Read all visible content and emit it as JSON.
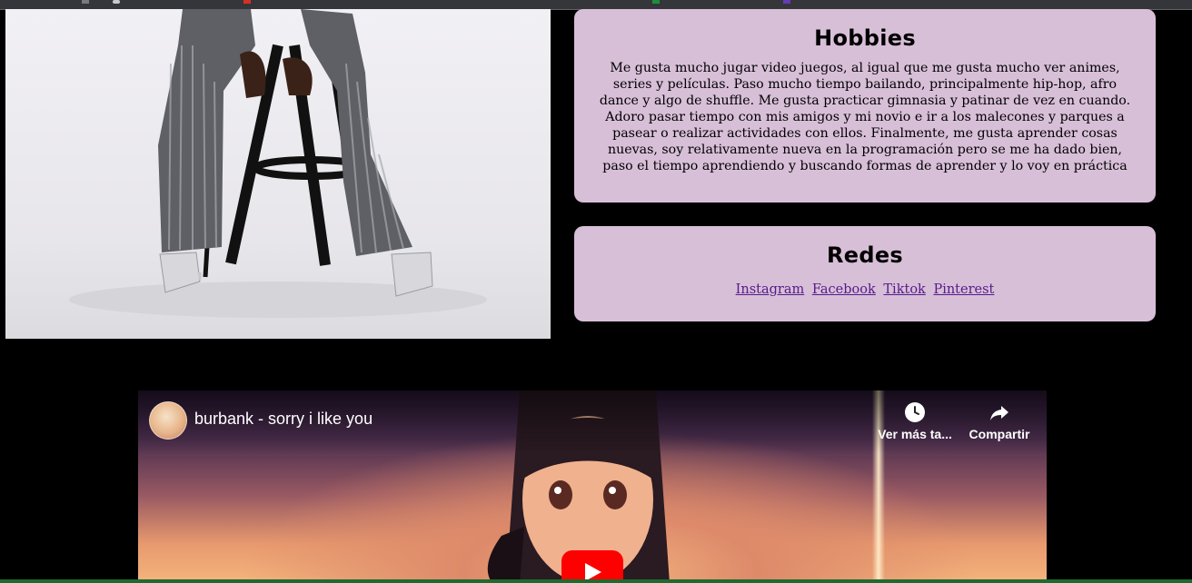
{
  "hobbies": {
    "title": "Hobbies",
    "text": "Me gusta mucho jugar video juegos, al igual que me gusta mucho ver animes, series y películas. Paso mucho tiempo bailando, principalmente hip-hop, afro dance y algo de shuffle. Me gusta practicar gimnasia y patinar de vez en cuando. Adoro pasar tiempo con mis amigos y mi novio e ir a los malecones y parques a pasear o realizar actividades con ellos. Finalmente, me gusta aprender cosas nuevas, soy relativamente nueva en la programación pero se me ha dado bien, paso el tiempo aprendiendo y buscando formas de aprender y lo voy en práctica"
  },
  "redes": {
    "title": "Redes",
    "links": [
      "Instagram",
      "Facebook",
      "Tiktok",
      "Pinterest"
    ]
  },
  "video": {
    "title": "burbank - sorry i like you",
    "watch_later": "Ver más ta...",
    "share": "Compartir"
  },
  "icons": {
    "watch_later": "clock-icon",
    "share": "share-arrow-icon",
    "play": "play-icon"
  },
  "colors": {
    "card_bg": "#d8bfd8",
    "link": "#551a8b",
    "page_bg": "#000000",
    "play_button": "#ff0000"
  }
}
